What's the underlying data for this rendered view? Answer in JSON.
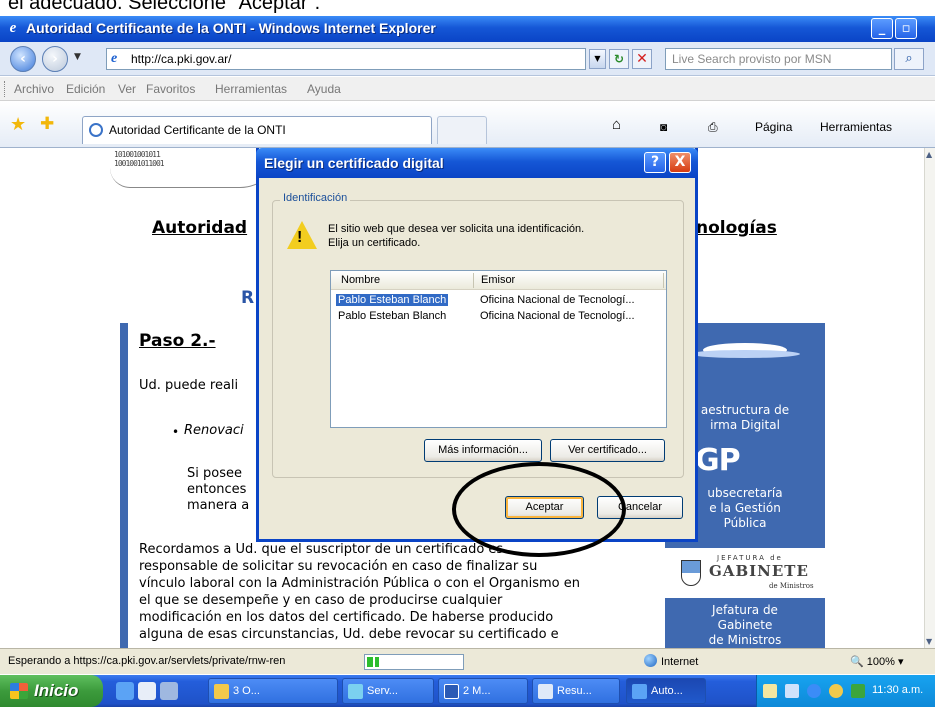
{
  "caption": "el adecuado. Seleccione \"Aceptar\".",
  "window": {
    "title": "Autoridad Certificante de la ONTI - Windows Internet Explorer",
    "min": "_",
    "max": "▫"
  },
  "address": {
    "url": "http://ca.pki.gov.ar/",
    "search_placeholder": "Live Search provisto por MSN"
  },
  "menu": [
    "Archivo",
    "Edición",
    "Ver",
    "Favoritos",
    "Herramientas",
    "Ayuda"
  ],
  "tab": {
    "label": "Autoridad Certificante de la ONTI"
  },
  "commands": {
    "pagina": "Página",
    "herramientas": "Herramientas"
  },
  "page": {
    "heading_left": "Autoridad",
    "heading_right": "nologías",
    "sub": "R",
    "paso": "Paso 2.-",
    "line1": "Ud. puede reali",
    "bullet_text": "Renovaci",
    "si_lines": [
      "Si posee",
      "entonces",
      "manera a"
    ],
    "recuerdo": [
      "Recordamos a Ud. que el suscriptor de un certificado es",
      "responsable de solicitar su revocación en caso de finalizar su",
      "vínculo laboral con la Administración Pública o con el Organismo en",
      "el que se desempeñe y en caso de producirse cualquier",
      "modificación en los datos del certificado. De haberse producido",
      "alguna de esas circunstancias, Ud. debe revocar su certificado e"
    ],
    "right_col": {
      "infra": [
        "aestructura de",
        "irma Digital"
      ],
      "sgp": "GP",
      "subsec": [
        "ubsecretaría",
        "e la Gestión",
        "Pública"
      ],
      "gab_top": "JEFATURA de",
      "gab": "GABINETE",
      "gab_min": "de Ministros",
      "jefatura": [
        "Jefatura de",
        "Gabinete",
        "de Ministros"
      ]
    }
  },
  "dialog": {
    "title": "Elegir un certificado digital",
    "help": "?",
    "close": "X",
    "group": "Identificación",
    "message": [
      "El sitio web que desea ver solicita una identificación.",
      "Elija un certificado."
    ],
    "columns": [
      "Nombre",
      "Emisor"
    ],
    "rows": [
      {
        "nombre": "Pablo Esteban Blanch",
        "emisor": "Oficina Nacional de Tecnologí...",
        "selected": true
      },
      {
        "nombre": "Pablo Esteban Blanch",
        "emisor": "Oficina Nacional de Tecnologí...",
        "selected": false
      }
    ],
    "more_info": "Más información...",
    "view_cert": "Ver certificado...",
    "accept": "Aceptar",
    "cancel": "Cancelar"
  },
  "status": {
    "text": "Esperando a https://ca.pki.gov.ar/servlets/private/rnw-ren",
    "progress": 0.12,
    "zone": "Internet",
    "zoom": "100%"
  },
  "taskbar": {
    "start": "Inicio",
    "buttons": [
      "3 O...",
      "Serv...",
      "2 M...",
      "Resu...",
      "Auto..."
    ],
    "time": "11:30 a.m."
  },
  "colors": {
    "xp_blue": "#0a44c6",
    "selection": "#316ac5",
    "page_blue": "#3f69b0"
  }
}
